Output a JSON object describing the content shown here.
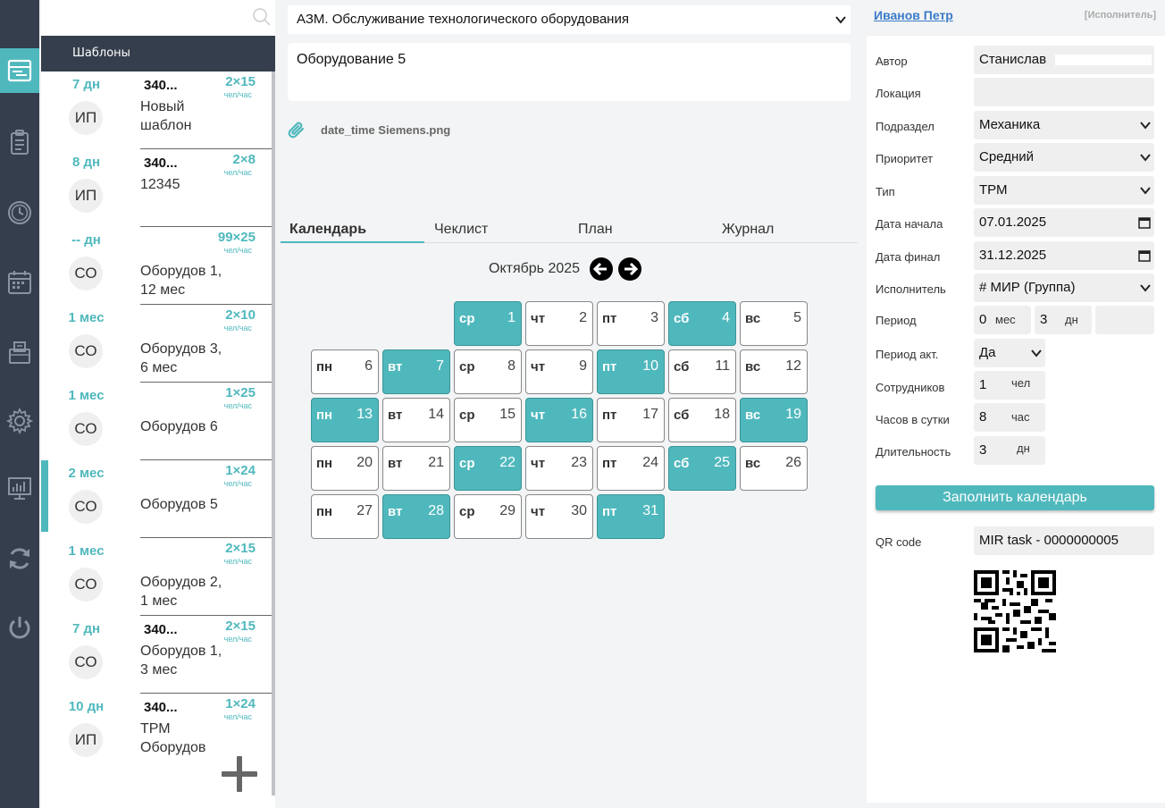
{
  "nav": {
    "items": [
      {
        "icon": "tasks-panel-icon",
        "active": true
      },
      {
        "icon": "clipboard-icon",
        "active": false
      },
      {
        "icon": "clock-icon",
        "active": false
      },
      {
        "icon": "calendar-icon",
        "active": false
      },
      {
        "icon": "folder-icon",
        "active": false
      },
      {
        "icon": "gear-icon",
        "active": false
      },
      {
        "icon": "chart-icon",
        "active": false
      },
      {
        "icon": "refresh-icon",
        "active": false
      },
      {
        "icon": "power-icon",
        "active": false
      }
    ]
  },
  "templates": {
    "header": "Шаблоны",
    "items": [
      {
        "duration": "7 дн",
        "initials": "ИП",
        "code": "340...",
        "name": "Новый шаблон",
        "staff": "2×15",
        "unit": "чел/час",
        "selected": false
      },
      {
        "duration": "8 дн",
        "initials": "ИП",
        "code": "340...",
        "name": "12345",
        "staff": "2×8",
        "unit": "чел/час",
        "selected": false
      },
      {
        "duration": "-- дн",
        "initials": "СО",
        "code": "",
        "name": "Оборудов 1, 12 мес",
        "staff": "99×25",
        "unit": "чел/час",
        "selected": false
      },
      {
        "duration": "1 мес",
        "initials": "СО",
        "code": "",
        "name": "Оборудов 3, 6 мес",
        "staff": "2×10",
        "unit": "чел/час",
        "selected": false
      },
      {
        "duration": "1 мес",
        "initials": "СО",
        "code": "",
        "name": "Оборудов 6",
        "staff": "1×25",
        "unit": "чел/час",
        "selected": false
      },
      {
        "duration": "2 мес",
        "initials": "СО",
        "code": "",
        "name": "Оборудов 5",
        "staff": "1×24",
        "unit": "чел/час",
        "selected": true
      },
      {
        "duration": "1 мес",
        "initials": "СО",
        "code": "",
        "name": "Оборудов 2, 1 мес",
        "staff": "2×15",
        "unit": "чел/час",
        "selected": false
      },
      {
        "duration": "7 дн",
        "initials": "СО",
        "code": "340...",
        "name": "Оборудов 1, 3 мес",
        "staff": "2×15",
        "unit": "чел/час",
        "selected": false
      },
      {
        "duration": "10 дн",
        "initials": "ИП",
        "code": "340...",
        "name": "ТРМ Оборудов",
        "staff": "1×24",
        "unit": "чел/час",
        "selected": false
      }
    ]
  },
  "main": {
    "title": "АЗМ. Обслуживание технологического оборудования",
    "description": "Оборудование 5",
    "attachment": "date_time Siemens.png",
    "tabs": [
      "Календарь",
      "Чеклист",
      "План",
      "Журнал"
    ],
    "month": "Октябрь 2025"
  },
  "calendar": {
    "days": [
      {
        "wd": "ср",
        "d": "1",
        "on": true
      },
      {
        "wd": "чт",
        "d": "2",
        "on": false
      },
      {
        "wd": "пт",
        "d": "3",
        "on": false
      },
      {
        "wd": "сб",
        "d": "4",
        "on": true
      },
      {
        "wd": "вс",
        "d": "5",
        "on": false
      },
      {
        "wd": "пн",
        "d": "6",
        "on": false
      },
      {
        "wd": "вт",
        "d": "7",
        "on": true
      },
      {
        "wd": "ср",
        "d": "8",
        "on": false
      },
      {
        "wd": "чт",
        "d": "9",
        "on": false
      },
      {
        "wd": "пт",
        "d": "10",
        "on": true
      },
      {
        "wd": "сб",
        "d": "11",
        "on": false
      },
      {
        "wd": "вс",
        "d": "12",
        "on": false
      },
      {
        "wd": "пн",
        "d": "13",
        "on": true
      },
      {
        "wd": "вт",
        "d": "14",
        "on": false
      },
      {
        "wd": "ср",
        "d": "15",
        "on": false
      },
      {
        "wd": "чт",
        "d": "16",
        "on": true
      },
      {
        "wd": "пт",
        "d": "17",
        "on": false
      },
      {
        "wd": "сб",
        "d": "18",
        "on": false
      },
      {
        "wd": "вс",
        "d": "19",
        "on": true
      },
      {
        "wd": "пн",
        "d": "20",
        "on": false
      },
      {
        "wd": "вт",
        "d": "21",
        "on": false
      },
      {
        "wd": "ср",
        "d": "22",
        "on": true
      },
      {
        "wd": "чт",
        "d": "23",
        "on": false
      },
      {
        "wd": "пт",
        "d": "24",
        "on": false
      },
      {
        "wd": "сб",
        "d": "25",
        "on": true
      },
      {
        "wd": "вс",
        "d": "26",
        "on": false
      },
      {
        "wd": "пн",
        "d": "27",
        "on": false
      },
      {
        "wd": "вт",
        "d": "28",
        "on": true
      },
      {
        "wd": "ср",
        "d": "29",
        "on": false
      },
      {
        "wd": "чт",
        "d": "30",
        "on": false
      },
      {
        "wd": "пт",
        "d": "31",
        "on": true
      }
    ]
  },
  "user": {
    "name": "Иванов Петр",
    "role": "[Исполнитель]"
  },
  "props": {
    "author_label": "Автор",
    "author_value": "Станислав",
    "location_label": "Локация",
    "location_value": "",
    "division_label": "Подраздел",
    "division_value": "Механика",
    "priority_label": "Приоритет",
    "priority_value": "Средний",
    "type_label": "Тип",
    "type_value": "ТРМ",
    "start_label": "Дата начала",
    "start_value": "07.01.2025",
    "end_label": "Дата финал",
    "end_value": "31.12.2025",
    "executor_label": "Исполнитель",
    "executor_value": "# МИР (Группа)",
    "period_label": "Период",
    "period_months": "0",
    "period_months_unit": "мес",
    "period_days": "3",
    "period_days_unit": "дн",
    "period_act_label": "Период акт.",
    "period_act_value": "Да",
    "staff_label": "Сотрудников",
    "staff_value": "1",
    "staff_unit": "чел",
    "hours_label": "Часов в сутки",
    "hours_value": "8",
    "hours_unit": "час",
    "duration_label": "Длительность",
    "duration_value": "3",
    "duration_unit": "дн",
    "fill_button": "Заполнить календарь",
    "qr_label": "QR code",
    "qr_value": "MIR task - 0000000005"
  },
  "colors": {
    "accent": "#4fb8bd",
    "nav_bg": "#353e4c",
    "link": "#3a7bc8"
  }
}
